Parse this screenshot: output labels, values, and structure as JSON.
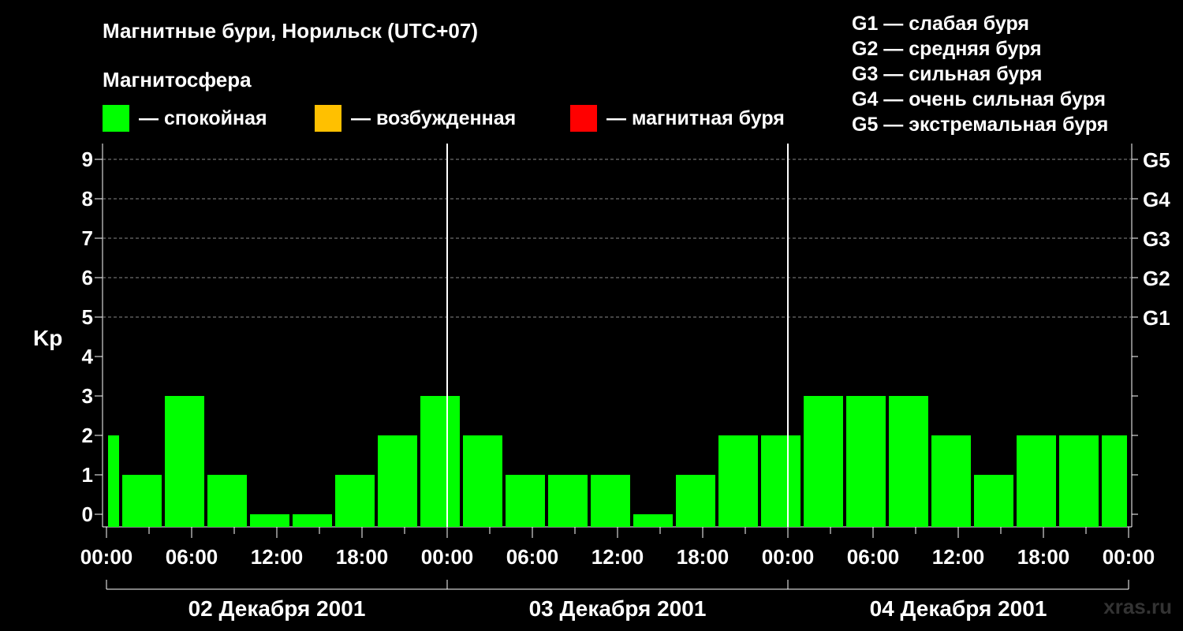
{
  "title": "Магнитные бури, Норильск (UTC+07)",
  "legend": {
    "heading": "Магнитосфера",
    "items": [
      {
        "label": "— спокойная",
        "color": "#00ff00"
      },
      {
        "label": "— возбужденная",
        "color": "#ffc000"
      },
      {
        "label": "— магнитная буря",
        "color": "#ff0000"
      }
    ]
  },
  "g_levels": [
    "G1 — слабая буря",
    "G2 — средняя буря",
    "G3 — сильная буря",
    "G4 — очень сильная буря",
    "G5 — экстремальная буря"
  ],
  "watermark": "xras.ru",
  "chart_data": {
    "type": "bar",
    "ylabel": "Kp",
    "ylim": [
      0,
      9
    ],
    "yticks": [
      0,
      1,
      2,
      3,
      4,
      5,
      6,
      7,
      8,
      9
    ],
    "y_right_labels": [
      {
        "value": 5,
        "label": "G1"
      },
      {
        "value": 6,
        "label": "G2"
      },
      {
        "value": 7,
        "label": "G3"
      },
      {
        "value": 8,
        "label": "G4"
      },
      {
        "value": 9,
        "label": "G5"
      }
    ],
    "grid": "dashed horizontal at 5-9",
    "bar_color": "#00ff00",
    "x_tick_labels": [
      "00:00",
      "06:00",
      "12:00",
      "18:00",
      "00:00",
      "06:00",
      "12:00",
      "18:00",
      "00:00",
      "06:00",
      "12:00",
      "18:00",
      "00:00"
    ],
    "days": [
      "02 Декабря 2001",
      "03 Декабря 2001",
      "04 Декабря 2001"
    ],
    "series": [
      {
        "values": [
          {
            "start": "02 Декабря 2001 00:00",
            "end": "02 Декабря 2001 01:00",
            "kp": 2
          },
          {
            "start": "02 Декабря 2001 01:00",
            "end": "02 Декабря 2001 04:00",
            "kp": 1
          },
          {
            "start": "02 Декабря 2001 04:00",
            "end": "02 Декабря 2001 07:00",
            "kp": 3
          },
          {
            "start": "02 Декабря 2001 07:00",
            "end": "02 Декабря 2001 10:00",
            "kp": 1
          },
          {
            "start": "02 Декабря 2001 10:00",
            "end": "02 Декабря 2001 13:00",
            "kp": 0
          },
          {
            "start": "02 Декабря 2001 13:00",
            "end": "02 Декабря 2001 16:00",
            "kp": 0
          },
          {
            "start": "02 Декабря 2001 16:00",
            "end": "02 Декабря 2001 19:00",
            "kp": 1
          },
          {
            "start": "02 Декабря 2001 19:00",
            "end": "02 Декабря 2001 22:00",
            "kp": 2
          },
          {
            "start": "02 Декабря 2001 22:00",
            "end": "03 Декабря 2001 01:00",
            "kp": 3
          },
          {
            "start": "03 Декабря 2001 01:00",
            "end": "03 Декабря 2001 04:00",
            "kp": 2
          },
          {
            "start": "03 Декабря 2001 04:00",
            "end": "03 Декабря 2001 07:00",
            "kp": 1
          },
          {
            "start": "03 Декабря 2001 07:00",
            "end": "03 Декабря 2001 10:00",
            "kp": 1
          },
          {
            "start": "03 Декабря 2001 10:00",
            "end": "03 Декабря 2001 13:00",
            "kp": 1
          },
          {
            "start": "03 Декабря 2001 13:00",
            "end": "03 Декабря 2001 16:00",
            "kp": 0
          },
          {
            "start": "03 Декабря 2001 16:00",
            "end": "03 Декабря 2001 19:00",
            "kp": 1
          },
          {
            "start": "03 Декабря 2001 19:00",
            "end": "03 Декабря 2001 22:00",
            "kp": 2
          },
          {
            "start": "03 Декабря 2001 22:00",
            "end": "04 Декабря 2001 01:00",
            "kp": 2
          },
          {
            "start": "04 Декабря 2001 01:00",
            "end": "04 Декабря 2001 04:00",
            "kp": 3
          },
          {
            "start": "04 Декабря 2001 04:00",
            "end": "04 Декабря 2001 07:00",
            "kp": 3
          },
          {
            "start": "04 Декабря 2001 07:00",
            "end": "04 Декабря 2001 10:00",
            "kp": 3
          },
          {
            "start": "04 Декабря 2001 10:00",
            "end": "04 Декабря 2001 13:00",
            "kp": 2
          },
          {
            "start": "04 Декабря 2001 13:00",
            "end": "04 Декабря 2001 16:00",
            "kp": 1
          },
          {
            "start": "04 Декабря 2001 16:00",
            "end": "04 Декабря 2001 19:00",
            "kp": 2
          },
          {
            "start": "04 Декабря 2001 19:00",
            "end": "04 Декабря 2001 22:00",
            "kp": 2
          },
          {
            "start": "04 Декабря 2001 22:00",
            "end": "05 Декабря 2001 00:00",
            "kp": 2
          }
        ]
      }
    ]
  }
}
